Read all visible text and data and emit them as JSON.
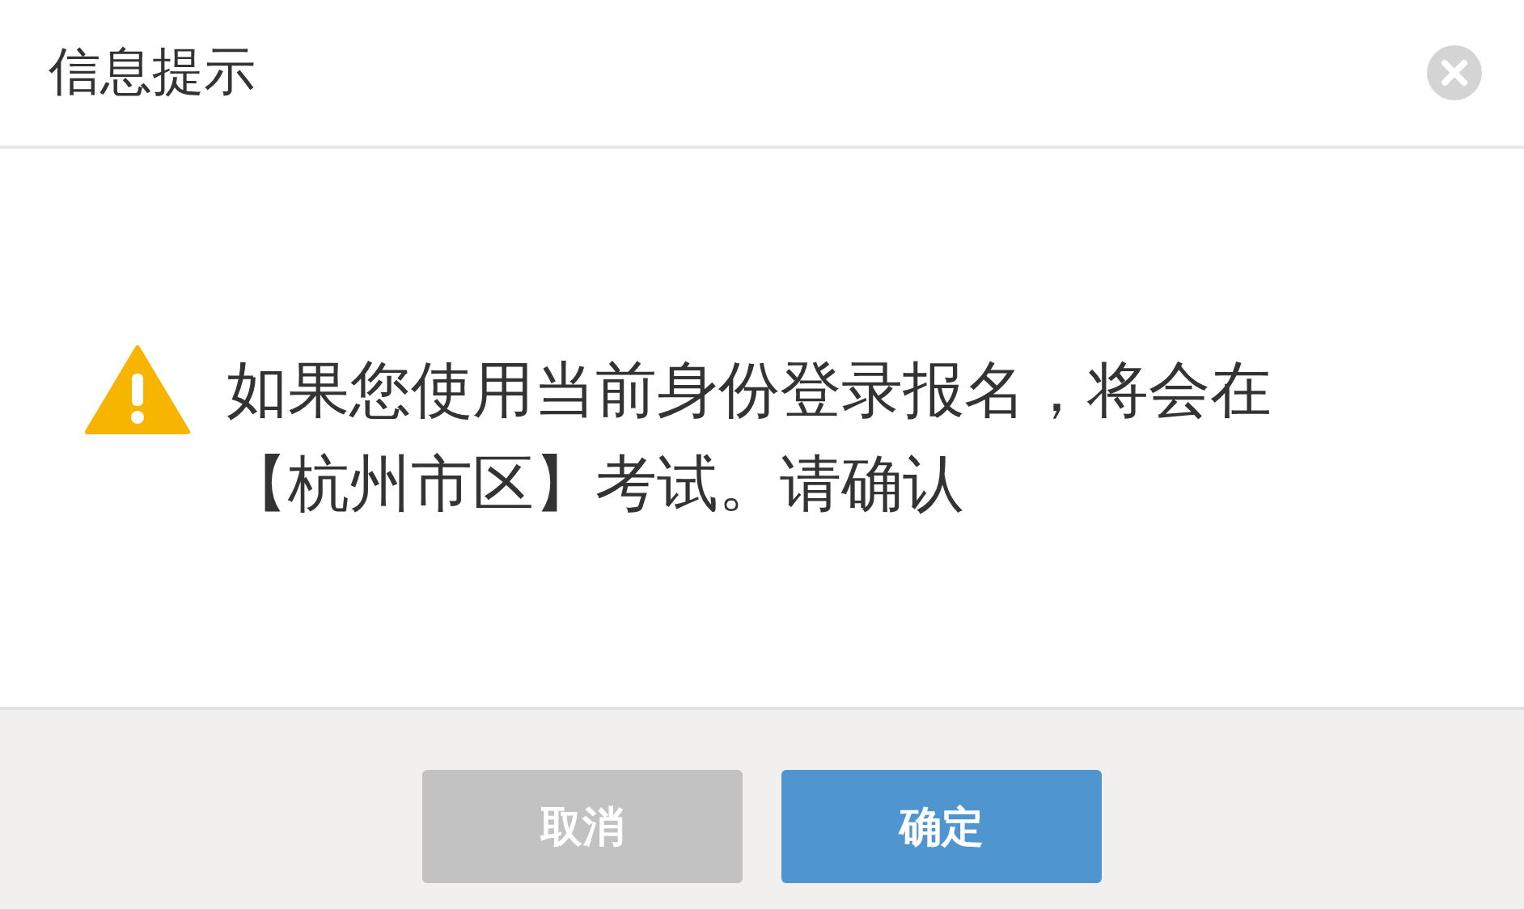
{
  "dialog": {
    "title": "信息提示",
    "message": "如果您使用当前身份登录报名，将会在【杭州市区】考试。请确认",
    "buttons": [
      {
        "label": "取消",
        "kind": "secondary"
      },
      {
        "label": "确定",
        "kind": "primary"
      }
    ]
  }
}
